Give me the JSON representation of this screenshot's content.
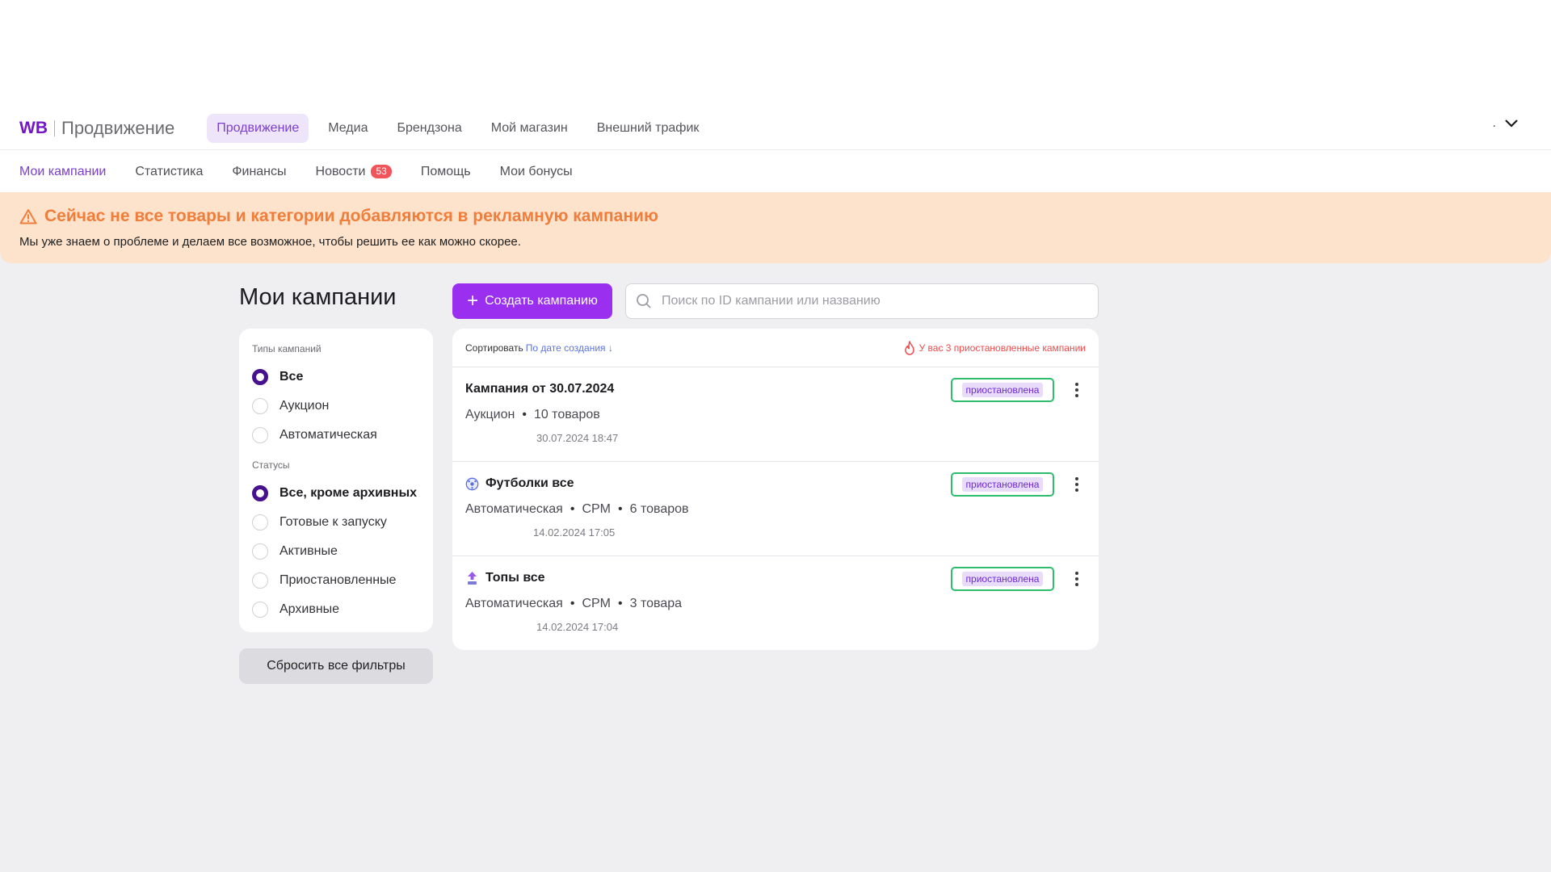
{
  "header": {
    "logo_brand": "WB",
    "logo_product": "Продвижение",
    "nav": [
      "Продвижение",
      "Медиа",
      "Брендзона",
      "Мой магазин",
      "Внешний трафик"
    ],
    "active_nav": "Продвижение",
    "user_label": "."
  },
  "subnav": {
    "items": [
      "Мои кампании",
      "Статистика",
      "Финансы",
      "Новости",
      "Помощь",
      "Мои бонусы"
    ],
    "active": "Мои кампании",
    "news_badge": "53"
  },
  "alert": {
    "title": "Сейчас не все товары и категории добавляются в рекламную кампанию",
    "text": "Мы уже знаем о проблеме и делаем все возможное, чтобы решить ее как можно скорее.",
    "color": "#f07d3a"
  },
  "page_title": "Мои кампании",
  "filters": {
    "types_label": "Типы кампаний",
    "types": [
      {
        "label": "Все",
        "checked": true
      },
      {
        "label": "Аукцион",
        "checked": false
      },
      {
        "label": "Автоматическая",
        "checked": false
      }
    ],
    "statuses_label": "Статусы",
    "statuses": [
      {
        "label": "Все, кроме архивных",
        "checked": true
      },
      {
        "label": "Готовые к запуску",
        "checked": false
      },
      {
        "label": "Активные",
        "checked": false
      },
      {
        "label": "Приостановленные",
        "checked": false
      },
      {
        "label": "Архивные",
        "checked": false
      }
    ],
    "reset_label": "Сбросить все фильтры"
  },
  "toolbar": {
    "create_label": "Создать кампанию",
    "search_placeholder": "Поиск по ID кампании или названию"
  },
  "list": {
    "sort_label": "Сортировать",
    "sort_value": "По дате создания ↓",
    "warning": "У вас 3 приостановленные кампании",
    "campaigns": [
      {
        "name": "Кампания от 30.07.2024",
        "icon": "none",
        "meta": [
          "Аукцион",
          "10 товаров"
        ],
        "date": "30.07.2024 18:47",
        "status": "приостановлена"
      },
      {
        "name": "Футболки все",
        "icon": "globe-icon",
        "meta": [
          "Автоматическая",
          "CPM",
          "6 товаров"
        ],
        "date": "14.02.2024 17:05",
        "status": "приостановлена"
      },
      {
        "name": "Топы все",
        "icon": "top-arrow-icon",
        "meta": [
          "Автоматическая",
          "CPM",
          "3 товара"
        ],
        "date": "14.02.2024 17:04",
        "status": "приостановлена"
      }
    ]
  },
  "colors": {
    "accent": "#9a2ff0",
    "status_border": "#2ebd6a",
    "warning": "#f04a4a"
  }
}
